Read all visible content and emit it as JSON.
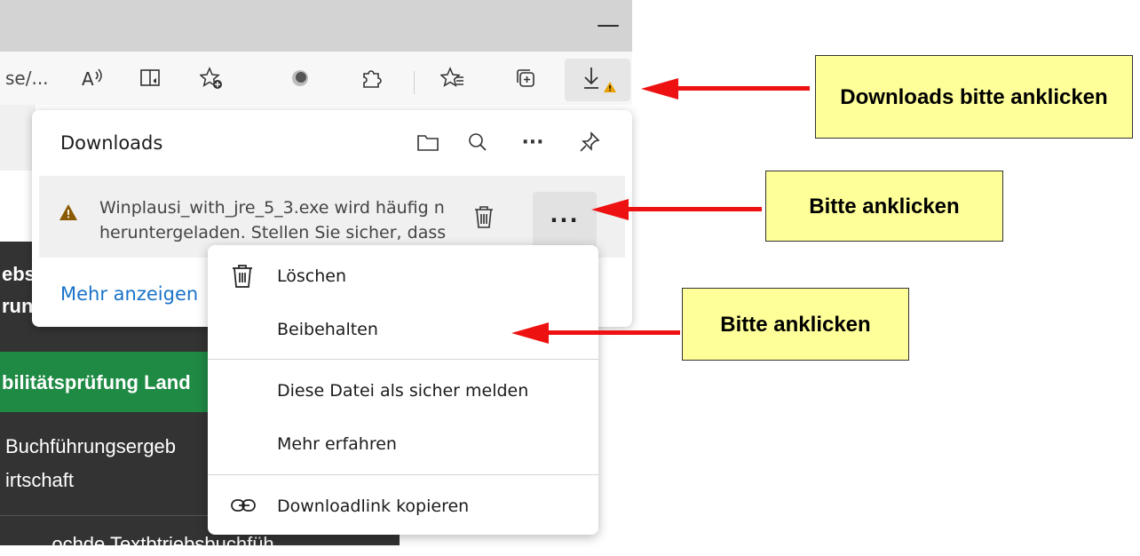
{
  "browser": {
    "minimize_glyph": "—",
    "address_fragment": "se/...",
    "accent_color": "#e8a200"
  },
  "toolbar": {
    "icons": [
      "read-aloud-icon",
      "immersive-reader-icon",
      "add-favorite-icon",
      "profile-circle-icon",
      "extensions-icon",
      "favorites-icon",
      "collections-icon",
      "downloads-icon"
    ]
  },
  "background_page": {
    "dark_row1_line1": "ebs",
    "dark_row1_line2": "run",
    "green_row": "bilitätsprüfung Land",
    "row3_line1": "Buchführungsergeb",
    "row3_line2": "irtschaft",
    "row4": "...ochde Textbtriebsbuchfüh..."
  },
  "downloads_panel": {
    "title": "Downloads",
    "header_icons": [
      "open-folder-icon",
      "search-icon",
      "more-options-icon",
      "pin-icon"
    ],
    "item": {
      "filename_line": "Winplausi_with_jre_5_3.exe wird häufig n",
      "message_line": "heruntergeladen. Stellen Sie sicher, dass",
      "more_label": "···"
    },
    "more_link": "Mehr anzeigen"
  },
  "context_menu": {
    "items": [
      {
        "label": "Löschen",
        "icon": "trash-icon"
      },
      {
        "label": "Beibehalten",
        "icon": ""
      },
      {
        "label": "Diese Datei als sicher melden",
        "icon": ""
      },
      {
        "label": "Mehr erfahren",
        "icon": ""
      },
      {
        "label": "Downloadlink kopieren",
        "icon": "link-icon"
      }
    ]
  },
  "annotations": {
    "note1": "Downloads bitte anklicken",
    "note2": "Bitte anklicken",
    "note3": "Bitte anklicken",
    "arrow_color": "#ee1111",
    "note_color": "#ffff99"
  }
}
